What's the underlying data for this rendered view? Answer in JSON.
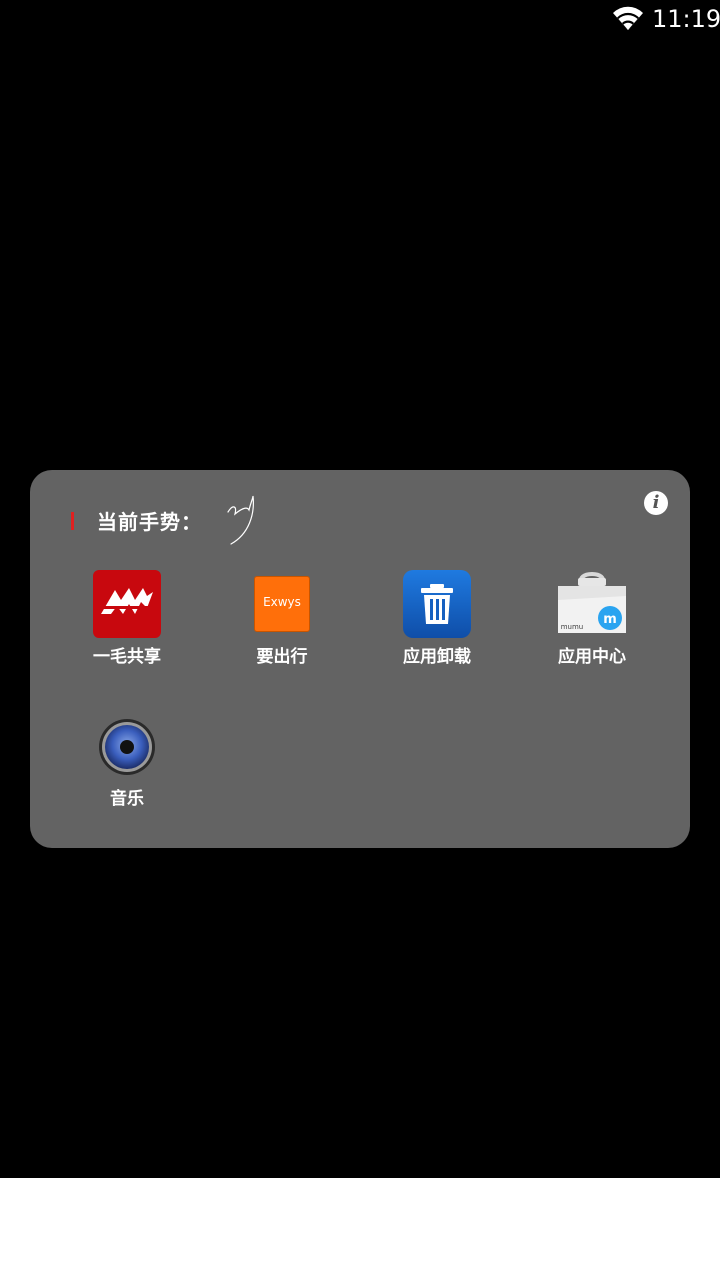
{
  "status": {
    "time": "11:19",
    "wifi_icon": "wifi-icon"
  },
  "panel": {
    "gesture_label": "当前手势：",
    "info_icon_glyph": "i",
    "apps": [
      {
        "label": "一毛共享",
        "icon": "yimao-gongxiang-icon"
      },
      {
        "label": "要出行",
        "icon": "yaochuxing-icon",
        "icon_text": "Exwys"
      },
      {
        "label": "应用卸载",
        "icon": "trash-icon"
      },
      {
        "label": "应用中心",
        "icon": "app-center-bag-icon",
        "icon_text": "mumu"
      },
      {
        "label": "音乐",
        "icon": "speaker-icon"
      }
    ]
  },
  "colors": {
    "panel_bg": "#636363",
    "accent_red": "#e02020",
    "yaochuxing_orange": "#ff6f0a",
    "uninstall_blue": "#1f7ae0"
  }
}
